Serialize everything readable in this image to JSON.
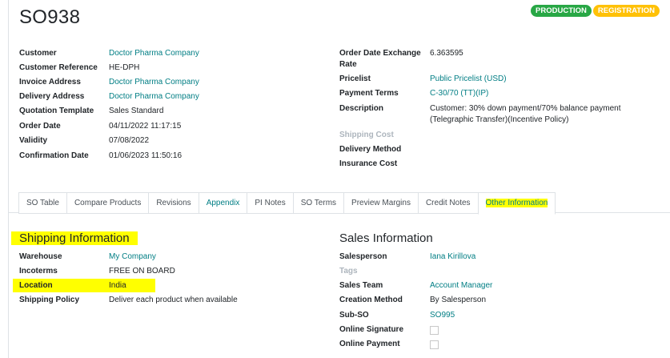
{
  "order": {
    "name": "SO938",
    "badges": [
      "PRODUCTION",
      "REGISTRATION"
    ]
  },
  "left_fields": [
    {
      "label": "Customer",
      "value": "Doctor Pharma Company"
    },
    {
      "label": "Customer Reference",
      "value": "HE-DPH"
    },
    {
      "label": "Invoice Address",
      "value": "Doctor Pharma Company"
    },
    {
      "label": "Delivery Address",
      "value": "Doctor Pharma Company"
    },
    {
      "label": "Quotation Template",
      "value": "Sales Standard"
    },
    {
      "label": "Order Date",
      "value": "04/11/2022 11:17:15"
    },
    {
      "label": "Validity",
      "value": "07/08/2022"
    },
    {
      "label": "Confirmation Date",
      "value": "01/06/2023 11:50:16"
    }
  ],
  "right_fields": {
    "exchange_rate_label_1": "Order Date Exchange",
    "exchange_rate_label_2": "Rate",
    "exchange_rate_value": "6.363595",
    "pricelist_label": "Pricelist",
    "pricelist_value": "Public Pricelist (USD)",
    "payment_terms_label": "Payment Terms",
    "payment_terms_value": "C-30/70 (TT)(IP)",
    "description_label": "Description",
    "description_value": "Customer: 30% down payment/70% balance payment (Telegraphic Transfer)(Incentive Policy)",
    "shipping_cost_label": "Shipping Cost",
    "delivery_method_label": "Delivery Method",
    "insurance_cost_label": "Insurance Cost"
  },
  "tabs": [
    "SO Table",
    "Compare Products",
    "Revisions",
    "Appendix",
    "PI Notes",
    "SO Terms",
    "Preview Margins",
    "Credit Notes",
    "Other Information"
  ],
  "shipping": {
    "title": "Shipping Information",
    "warehouse_label": "Warehouse",
    "warehouse_value": "My Company",
    "incoterms_label": "Incoterms",
    "incoterms_value": "FREE ON BOARD",
    "location_label": "Location",
    "location_value": "India",
    "policy_label": "Shipping Policy",
    "policy_value": "Deliver each product when available"
  },
  "sales": {
    "title": "Sales Information",
    "salesperson_label": "Salesperson",
    "salesperson_value": "Iana Kirillova",
    "tags_label": "Tags",
    "team_label": "Sales Team",
    "team_value": "Account Manager",
    "creation_label": "Creation Method",
    "creation_value": "By Salesperson",
    "subso_label": "Sub-SO",
    "subso_value": "SO995",
    "signature_label": "Online Signature",
    "payment_label": "Online Payment"
  },
  "colors": {
    "link": "#017e84",
    "highlight": "#ffff00",
    "production_badge": "#28a745",
    "registration_badge": "#ffc107"
  }
}
